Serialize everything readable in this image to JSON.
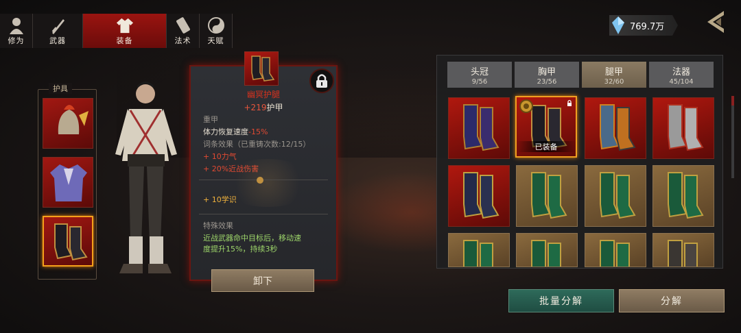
{
  "nav": {
    "tabs": [
      {
        "label": "修为",
        "icon": "cultivation-icon"
      },
      {
        "label": "武器",
        "icon": "weapon-icon"
      },
      {
        "label": "装备",
        "icon": "robe-icon",
        "active": true
      },
      {
        "label": "法术",
        "icon": "spell-scroll-icon"
      },
      {
        "label": "天赋",
        "icon": "yin-yang-icon"
      }
    ]
  },
  "currency": {
    "value": "769.7万",
    "icon": "crystal-icon"
  },
  "armor_panel": {
    "title": "护具",
    "selected_slot": 3
  },
  "tooltip": {
    "name": "幽冥护腿",
    "main_stat": "+219护甲",
    "main_stat_num": "+219",
    "main_stat_label": "护甲",
    "armor_type": "重甲",
    "stat_line_label": "体力恢复速度",
    "stat_line_value": "-15%",
    "affix_header": "词条效果（已重铸次数:12/15）",
    "affixes": [
      "+ 10力气",
      "+ 20%近战伤害"
    ],
    "bonus": "+ 10学识",
    "special_header": "特殊效果",
    "special_line1": "近战武器命中目标后，移动速",
    "special_line2": "度提升15%，持续3秒",
    "unequip_label": "卸下"
  },
  "categories": [
    {
      "name": "头冠",
      "count": "9/56"
    },
    {
      "name": "胸甲",
      "count": "23/56"
    },
    {
      "name": "腿甲",
      "count": "32/60",
      "active": true
    },
    {
      "name": "法器",
      "count": "45/104"
    }
  ],
  "inventory": {
    "equipped_label": "已装备",
    "items": [
      {
        "rarity": "red",
        "style": "blue-purple"
      },
      {
        "rarity": "red",
        "style": "dark-gold",
        "equipped": true,
        "locked": true,
        "selected": true
      },
      {
        "rarity": "red",
        "style": "blue-orange"
      },
      {
        "rarity": "red",
        "style": "silver-red"
      },
      {
        "rarity": "red",
        "style": "navy-gold"
      },
      {
        "rarity": "gold",
        "style": "green"
      },
      {
        "rarity": "gold",
        "style": "green"
      },
      {
        "rarity": "gold",
        "style": "green"
      },
      {
        "rarity": "gold",
        "style": "green"
      },
      {
        "rarity": "gold",
        "style": "green"
      },
      {
        "rarity": "gold",
        "style": "green"
      },
      {
        "rarity": "gold",
        "style": "dark-silver"
      }
    ]
  },
  "buttons": {
    "batch_dismantle": "批量分解",
    "dismantle": "分解"
  },
  "colors": {
    "accent_red": "#9a1410",
    "rarity_gold": "#8a6a3e",
    "stat_negative": "#e24a32",
    "special_text": "#9ed66a"
  }
}
